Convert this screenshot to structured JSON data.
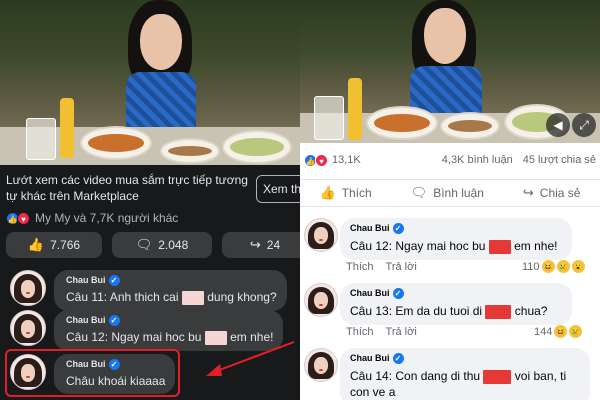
{
  "left": {
    "marketplace_text": "Lướt xem các video mua sắm trực tiếp tương tự khác trên Marketplace",
    "see_button": "Xem th",
    "reactions_text": "My My và 7,7K người khác",
    "pills": {
      "likes": "7.766",
      "comments": "2.048",
      "shares": "24"
    },
    "comments": [
      {
        "name": "Chau Bui",
        "text_before": "Câu 11:  Anh thich cai",
        "text_after": "dung khong?"
      },
      {
        "name": "Chau Bui",
        "text_before": "Câu 12: Ngay mai hoc bu",
        "text_after": "em nhe!"
      },
      {
        "name": "Chau Bui",
        "text_before": "Châu khoái kiaaaa",
        "text_after": ""
      }
    ]
  },
  "right": {
    "stats": {
      "reactions": "13,1K",
      "comments": "4,3K bình luận",
      "shares": "45 lượt chia sẻ"
    },
    "actions": {
      "like": "Thích",
      "comment": "Bình luận",
      "share": "Chia sẻ"
    },
    "comments": [
      {
        "name": "Chau Bui",
        "text_before": "Câu 12: Ngay mai hoc bu",
        "text_after": "em nhe!",
        "like": "Thích",
        "reply": "Trả lời",
        "count": "110"
      },
      {
        "name": "Chau Bui",
        "text_before": "Câu 13: Em da du tuoi di",
        "text_after": "chua?",
        "like": "Thích",
        "reply": "Trả lời",
        "count": "144"
      },
      {
        "name": "Chau Bui",
        "text_before": "Câu 14: Con dang di thu",
        "text_after": "voi ban, ti con ve a",
        "like": "",
        "reply": "",
        "count": ""
      }
    ]
  },
  "colors": {
    "fb_blue": "#1877f2",
    "highlight_red": "#e41e26",
    "redaction_light": "#f6d5d5",
    "redaction_red": "#e53935"
  }
}
